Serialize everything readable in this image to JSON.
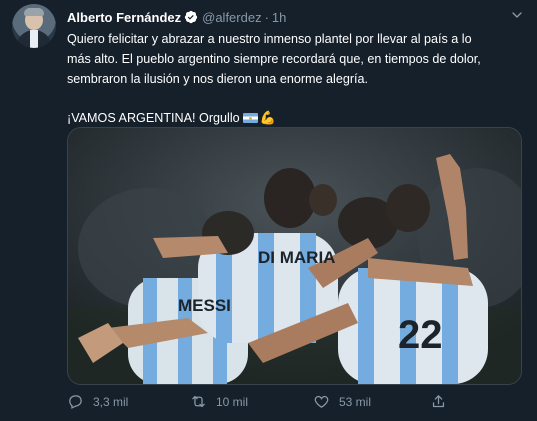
{
  "author": {
    "name": "Alberto Fernández",
    "handle": "@alferdez",
    "separator": "·",
    "time": "1h"
  },
  "tweet": {
    "line1": "Quiero felicitar y abrazar a nuestro inmenso plantel por llevar al país a lo",
    "line2": "más alto. El pueblo argentino siempre recordará que, en tiempos de dolor,",
    "line3": "sembraron la ilusión y nos dieron una enorme alegría.",
    "line4": "¡VAMOS ARGENTINA! Orgullo",
    "emojis": [
      "argentina-flag",
      "flexed-biceps"
    ]
  },
  "media": {
    "description_icons": [
      "photo"
    ],
    "jersey_names": [
      "DI MARIA",
      "MESSI",
      "22"
    ]
  },
  "actions": {
    "replies": "3,3 mil",
    "retweets": "10 mil",
    "likes": "53 mil"
  },
  "colors": {
    "background": "#15202b",
    "secondary_text": "#8899a6",
    "verified": "#1da1f2",
    "jersey_blue": "#74acdf"
  }
}
